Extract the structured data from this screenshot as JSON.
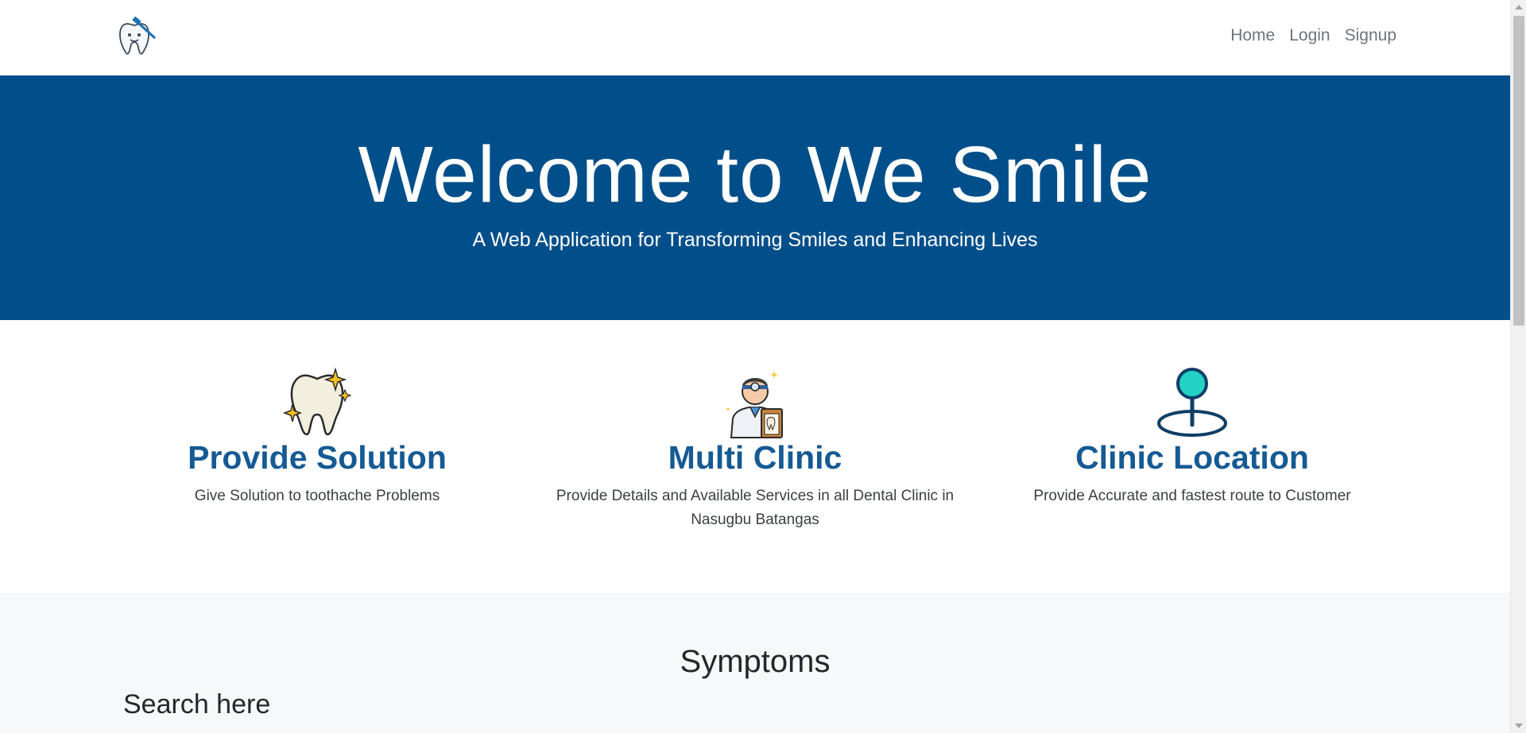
{
  "navbar": {
    "logo_icon": "tooth-logo-icon",
    "links": [
      {
        "label": "Home"
      },
      {
        "label": "Login"
      },
      {
        "label": "Signup"
      }
    ]
  },
  "hero": {
    "title": "Welcome to We Smile",
    "subtitle": "A Web Application for Transforming Smiles and Enhancing Lives",
    "background": "#014f8a"
  },
  "features": [
    {
      "icon": "sparkling-tooth-icon",
      "title": "Provide Solution",
      "description": "Give Solution to toothache Problems"
    },
    {
      "icon": "dentist-icon",
      "title": "Multi Clinic",
      "description": "Provide Details and Available Services in all Dental Clinic in Nasugbu Batangas"
    },
    {
      "icon": "location-pin-icon",
      "title": "Clinic Location",
      "description": "Provide Accurate and fastest route to Customer"
    }
  ],
  "symptoms": {
    "title": "Symptoms",
    "search_heading": "Search here"
  },
  "colors": {
    "accent": "#155a94",
    "hero_bg": "#014f8a",
    "section_bg": "#f7f8f9"
  }
}
